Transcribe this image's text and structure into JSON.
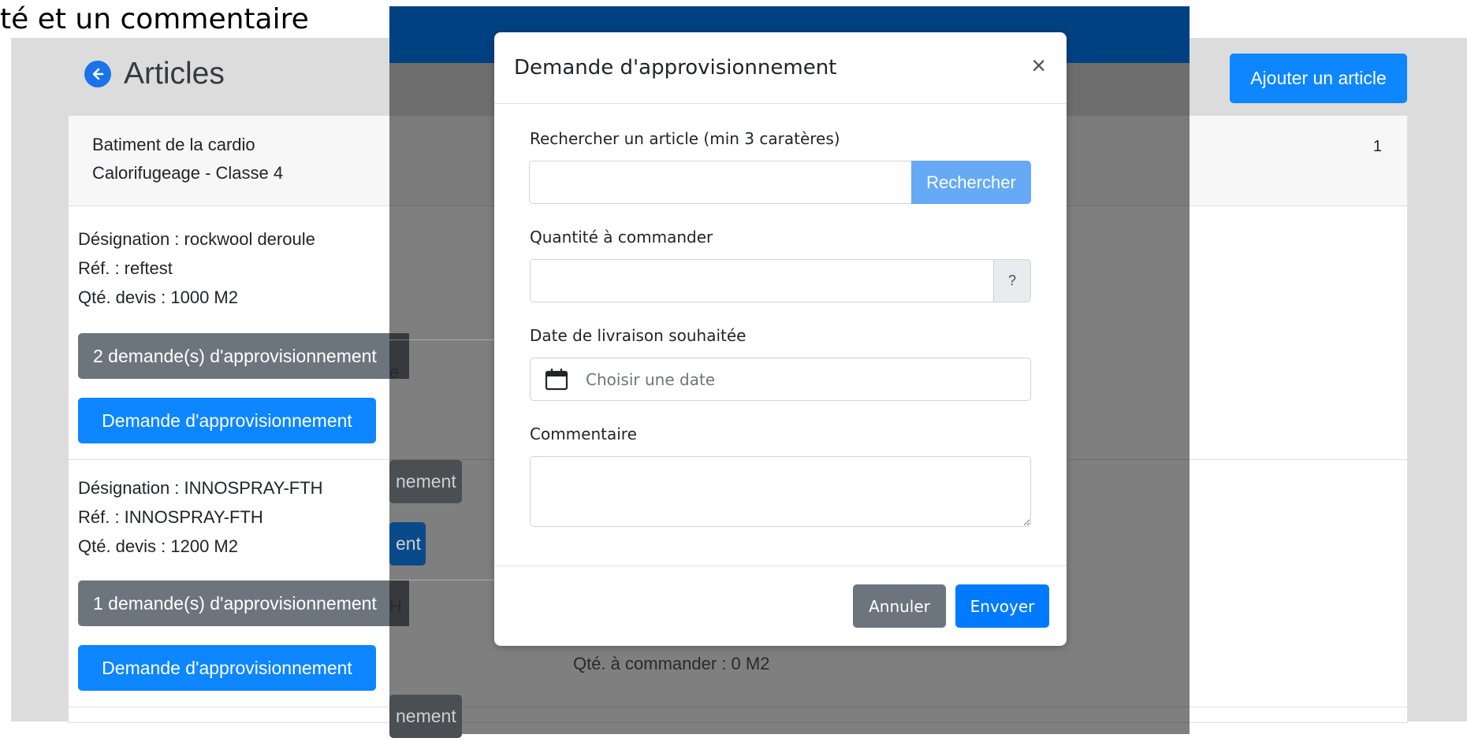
{
  "caption": "té et un commentaire",
  "page": {
    "title": "Articles",
    "add_button": "Ajouter un article"
  },
  "card": {
    "building": "Batiment de la cardio",
    "lot": "Calorifugeage - Classe 4",
    "count": "1"
  },
  "items": [
    {
      "designation": "Désignation : rockwool deroule",
      "ref": "Réf. : reftest",
      "qty": "Qté. devis : 1000 M2",
      "requests": "2 demande(s) d'approvisionnement",
      "request_button": "Demande d'approvisionnement"
    },
    {
      "designation": "Désignation : INNOSPRAY-FTH",
      "ref": "Réf. : INNOSPRAY-FTH",
      "qty": "Qté. devis : 1200 M2",
      "requests": "1 demande(s) d'approvisionnement",
      "request_button": "Demande d'approvisionnement"
    }
  ],
  "background": {
    "btn_fragment_1": "nement",
    "btn_fragment_2": "ent",
    "btn_fragment_3": "nement",
    "text_fragment_1": "e",
    "text_fragment_2": "H",
    "qty_to_order": "Qté. à commander : 0 M2"
  },
  "modal": {
    "title": "Demande d'approvisionnement",
    "close": "×",
    "search_label": "Rechercher un article (min 3 caratères)",
    "search_value": "",
    "search_button": "Rechercher",
    "quantity_label": "Quantité à commander",
    "quantity_value": "",
    "quantity_addon": "?",
    "date_label": "Date de livraison souhaitée",
    "date_placeholder": "Choisir une date",
    "comment_label": "Commentaire",
    "comment_value": "",
    "cancel_button": "Annuler",
    "send_button": "Envoyer"
  },
  "colors": {
    "primary": "#007bff",
    "secondary": "#6c757d",
    "header_band": "#004182"
  }
}
